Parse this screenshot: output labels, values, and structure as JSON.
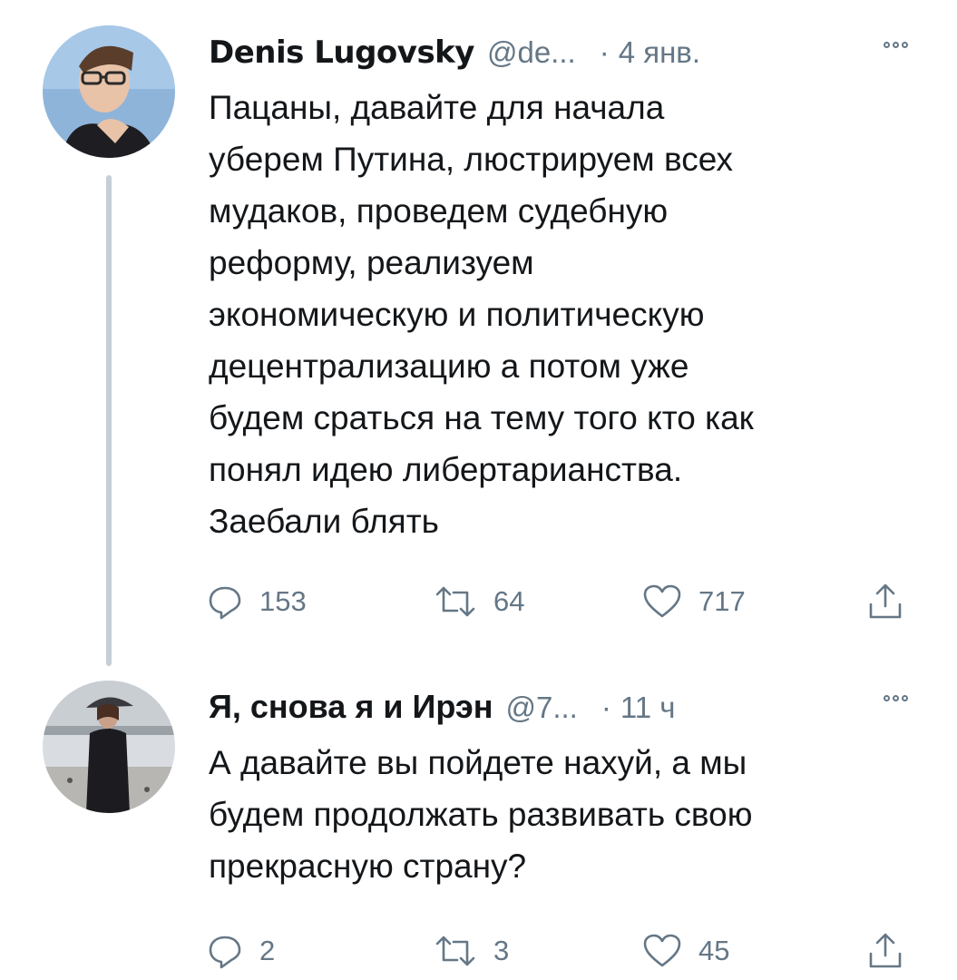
{
  "tweets": [
    {
      "author_name": "Denis Lugovsky",
      "handle": "@de...",
      "separator": "·",
      "time": "4 янв.",
      "text_lines": [
        "Пацаны, давайте для начала",
        "уберем Путина, люстрируем всех",
        "мудаков, проведем судебную",
        "реформу, реализуем",
        "экономическую и политическую",
        "децентрализацию а потом уже",
        "будем сраться на тему того кто как",
        "понял идею либертарианства.",
        "Заебали блять"
      ],
      "replies": "153",
      "retweets": "64",
      "likes": "717"
    },
    {
      "author_name": "Я, снова я и Ирэн",
      "handle": "@7...",
      "separator": "·",
      "time": "11 ч",
      "text_lines": [
        "А давайте вы пойдете нахуй, а мы",
        "будем продолжать развивать свою",
        "прекрасную страну?"
      ],
      "replies": "2",
      "retweets": "3",
      "likes": "45"
    }
  ],
  "icons": {
    "reply": "reply-icon",
    "retweet": "retweet-icon",
    "like": "like-icon",
    "share": "share-icon",
    "more": "more-icon"
  },
  "colors": {
    "text": "#14171a",
    "secondary": "#657786",
    "thread_line": "#c4cfd6"
  }
}
